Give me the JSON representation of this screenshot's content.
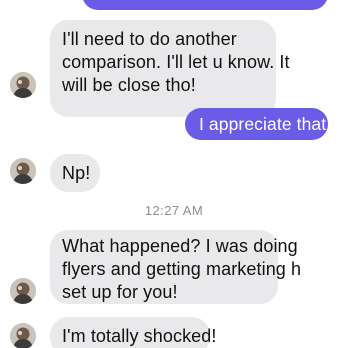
{
  "conversation": {
    "colors": {
      "sent_bubble": "#6b5ce7",
      "received_bubble": "#e9e9eb",
      "timestamp_text": "#8e8e93"
    },
    "messages": [
      {
        "direction": "received",
        "lines": [
          "I'll need to do another",
          "comparison.  I'll let u know. It",
          "will be close tho!"
        ]
      },
      {
        "direction": "sent",
        "text": "I appreciate that!"
      },
      {
        "direction": "received",
        "text": "Np!"
      },
      {
        "direction": "received",
        "lines": [
          "What happened? I was doing",
          "flyers and getting marketing h",
          "set up for you!"
        ]
      },
      {
        "direction": "received",
        "text": "I'm totally shocked!"
      }
    ],
    "timestamp": "12:27 AM",
    "avatar_icon": "profile-photo-icon"
  }
}
